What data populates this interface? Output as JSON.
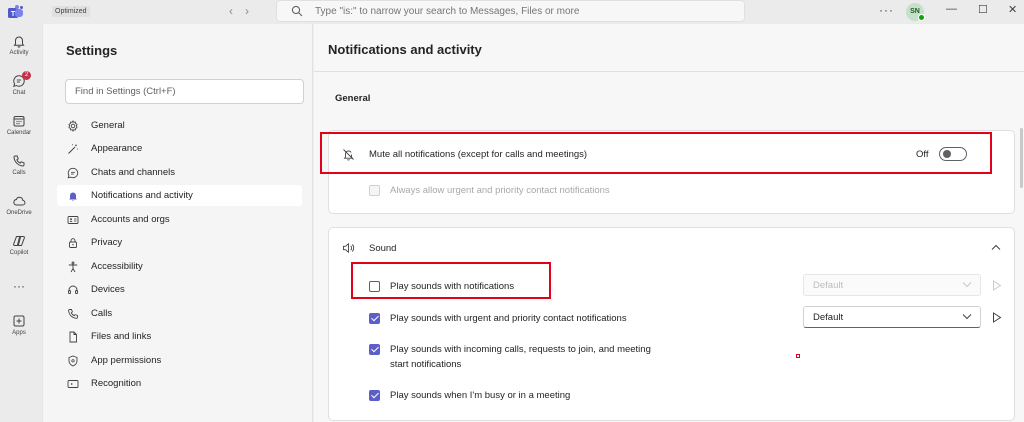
{
  "topbar": {
    "badge": "Optimized",
    "search_placeholder": "Type \"is:\" to narrow your search to Messages, Files or more",
    "more": "···",
    "avatar_initials": "SN",
    "minimize": "—",
    "maximize": "☐",
    "close": "✕"
  },
  "rail": [
    {
      "label": "Activity",
      "icon": "bell-icon"
    },
    {
      "label": "Chat",
      "icon": "chat-icon",
      "badge": "2"
    },
    {
      "label": "Calendar",
      "icon": "calendar-icon"
    },
    {
      "label": "Calls",
      "icon": "phone-icon"
    },
    {
      "label": "OneDrive",
      "icon": "cloud-icon"
    },
    {
      "label": "Copilot",
      "icon": "copilot-icon"
    },
    {
      "label": "",
      "icon": "more-icon",
      "text": "···"
    },
    {
      "label": "Apps",
      "icon": "plus-box-icon"
    }
  ],
  "settings": {
    "title": "Settings",
    "search_placeholder": "Find in Settings (Ctrl+F)",
    "items": [
      {
        "label": "General",
        "icon": "gear-icon"
      },
      {
        "label": "Appearance",
        "icon": "wand-icon"
      },
      {
        "label": "Chats and channels",
        "icon": "chat-bubble-icon"
      },
      {
        "label": "Notifications and activity",
        "icon": "bell-icon",
        "active": true
      },
      {
        "label": "Accounts and orgs",
        "icon": "id-card-icon"
      },
      {
        "label": "Privacy",
        "icon": "lock-icon"
      },
      {
        "label": "Accessibility",
        "icon": "accessibility-icon"
      },
      {
        "label": "Devices",
        "icon": "headset-icon"
      },
      {
        "label": "Calls",
        "icon": "phone-icon"
      },
      {
        "label": "Files and links",
        "icon": "file-icon"
      },
      {
        "label": "App permissions",
        "icon": "shield-icon"
      },
      {
        "label": "Recognition",
        "icon": "recognition-icon"
      }
    ]
  },
  "main": {
    "title": "Notifications and activity",
    "general_heading": "General",
    "mute_label": "Mute all notifications (except for calls and meetings)",
    "mute_state": "Off",
    "urgent_allow_label": "Always allow urgent and priority contact notifications",
    "sound_heading": "Sound",
    "sound_rows": [
      {
        "label": "Play sounds with notifications",
        "checked": false,
        "select": "Default",
        "select_enabled": false
      },
      {
        "label": "Play sounds with urgent and priority contact notifications",
        "checked": true,
        "select": "Default",
        "select_enabled": true
      },
      {
        "label": "Play sounds with incoming calls, requests to join, and meeting",
        "label2": "start notifications",
        "checked": true
      },
      {
        "label": "Play sounds when I'm busy or in a meeting",
        "checked": true
      }
    ]
  },
  "colors": {
    "accent": "#5b5fc7",
    "highlight": "#e3001b"
  }
}
